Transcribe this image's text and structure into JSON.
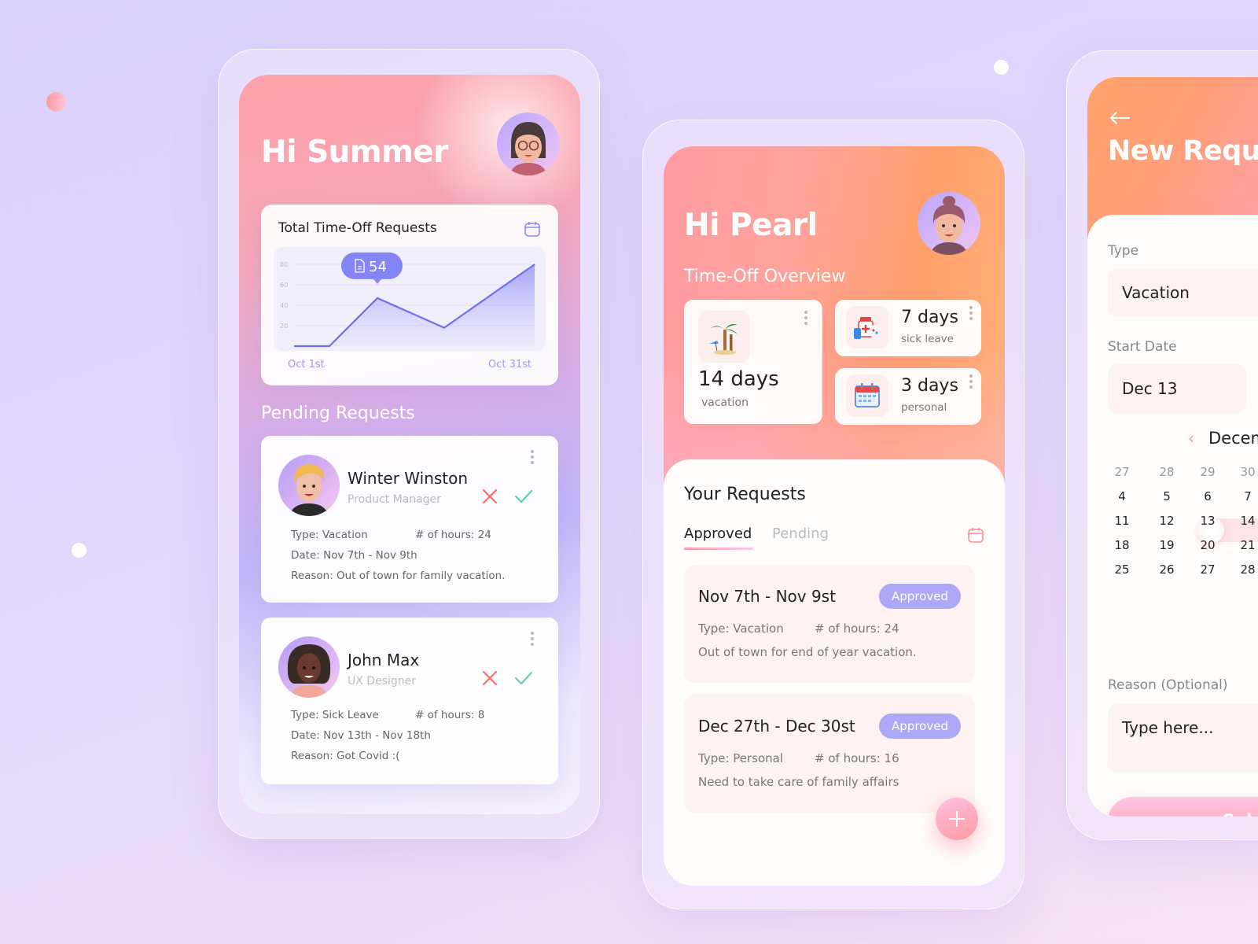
{
  "colors": {
    "accent_purple": "#7e7ef5",
    "badge_purple": "#aca8f8",
    "reject_red": "#ff6b6b",
    "approve_green": "#5fd0b5",
    "pink_accent": "#ff8c98"
  },
  "summer": {
    "greeting": "Hi Summer",
    "chart_card_title": "Total Time-Off Requests",
    "tooltip_value": "54",
    "pending_title": "Pending Requests",
    "requests": [
      {
        "name": "Winter Winston",
        "role": "Product Manager",
        "type": "Type: Vacation",
        "hours": "# of hours: 24",
        "date": "Date: Nov 7th - Nov 9th",
        "reason": "Reason: Out of town for family vacation."
      },
      {
        "name": "John Max",
        "role": "UX Designer",
        "type": "Type: Sick Leave",
        "hours": "# of hours: 8",
        "date": "Date: Nov 13th - Nov 18th",
        "reason": "Reason: Got Covid :("
      }
    ]
  },
  "chart_data": {
    "type": "area",
    "title": "Total Time-Off Requests",
    "x": [
      0,
      1,
      2,
      3,
      4
    ],
    "xlabels": [
      "Oct 1st",
      "Oct 31st"
    ],
    "values": [
      0,
      0,
      47,
      18,
      80
    ],
    "yticks": [
      20,
      40,
      60,
      80
    ],
    "ylim": [
      0,
      80
    ],
    "grid": true,
    "annotation": {
      "label": "54",
      "at_index": 2
    }
  },
  "pearl": {
    "greeting": "Hi Pearl",
    "overview_title": "Time-Off Overview",
    "stats": [
      {
        "value": "14 days",
        "label": "vacation",
        "icon": "palm-tree-icon"
      },
      {
        "value": "7 days",
        "label": "sick leave",
        "icon": "medicine-icon"
      },
      {
        "value": "3 days",
        "label": "personal",
        "icon": "calendar-icon"
      }
    ],
    "requests_title": "Your Requests",
    "tabs": [
      {
        "label": "Approved",
        "active": true
      },
      {
        "label": "Pending",
        "active": false
      }
    ],
    "approved": [
      {
        "date": "Nov 7th - Nov 9st",
        "status": "Approved",
        "type": "Type: Vacation",
        "hours": "# of hours: 24",
        "note": "Out of town for end of year vacation."
      },
      {
        "date": "Dec 27th - Dec 30st",
        "status": "Approved",
        "type": "Type: Personal",
        "hours": "# of hours: 16",
        "note": "Need to take care of family affairs"
      }
    ]
  },
  "new_request": {
    "title": "New Request",
    "type_label": "Type",
    "type_value": "Vacation",
    "start_label": "Start Date",
    "start_value": "Dec 13",
    "calendar_month": "December",
    "calendar_rows": [
      [
        "27",
        "28",
        "29",
        "30"
      ],
      [
        "4",
        "5",
        "6",
        "7"
      ],
      [
        "11",
        "12",
        "13",
        "14"
      ],
      [
        "18",
        "19",
        "20",
        "21"
      ],
      [
        "25",
        "26",
        "27",
        "28"
      ]
    ],
    "selected_day": "13",
    "reason_label": "Reason (Optional)",
    "reason_placeholder": "Type here...",
    "submit_label": "Submit"
  }
}
